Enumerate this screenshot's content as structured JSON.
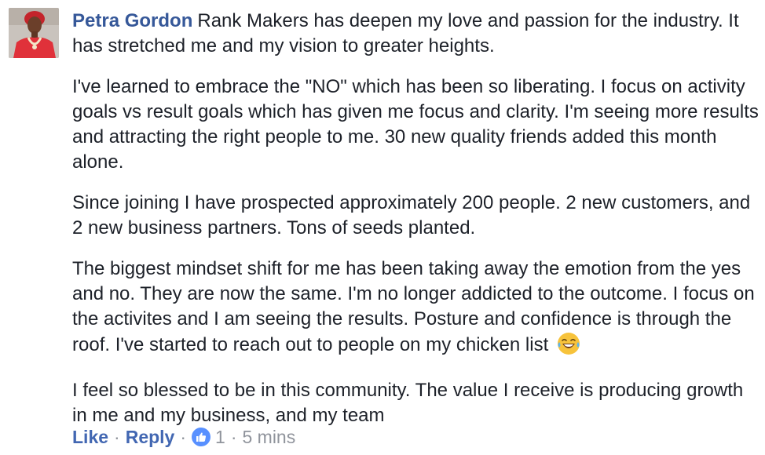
{
  "comment": {
    "author": "Petra Gordon",
    "paragraphs": [
      "Rank Makers has deepen my love and passion for the industry. It has stretched me and my vision to greater heights.",
      "I've learned to embrace the \"NO\" which has been so liberating. I focus on activity goals vs result goals which has given me focus and clarity. I'm seeing more results and attracting the right people to me. 30 new quality friends added this month alone.",
      "Since joining I have prospected approximately 200 people. 2 new customers, and 2 new business partners. Tons of seeds planted.",
      "The biggest mindset shift for me has been taking away the emotion from the yes and no. They are now the same. I'm no longer addicted to the outcome. I focus on the activites and I am seeing the results. Posture and confidence is through the roof. I've started to reach out to people on my chicken list",
      "I feel so blessed to be in this community. The value I receive is producing growth in me and my business, and my team"
    ],
    "emoji": "laughing-tears-emoji"
  },
  "actions": {
    "like_label": "Like",
    "reply_label": "Reply",
    "separator": "·",
    "reaction_count": "1",
    "timestamp": "5 mins"
  },
  "colors": {
    "author": "#365899",
    "action_link": "#4267b2",
    "meta": "#90949c",
    "like_badge": "#5890ff",
    "text": "#1d2129"
  }
}
